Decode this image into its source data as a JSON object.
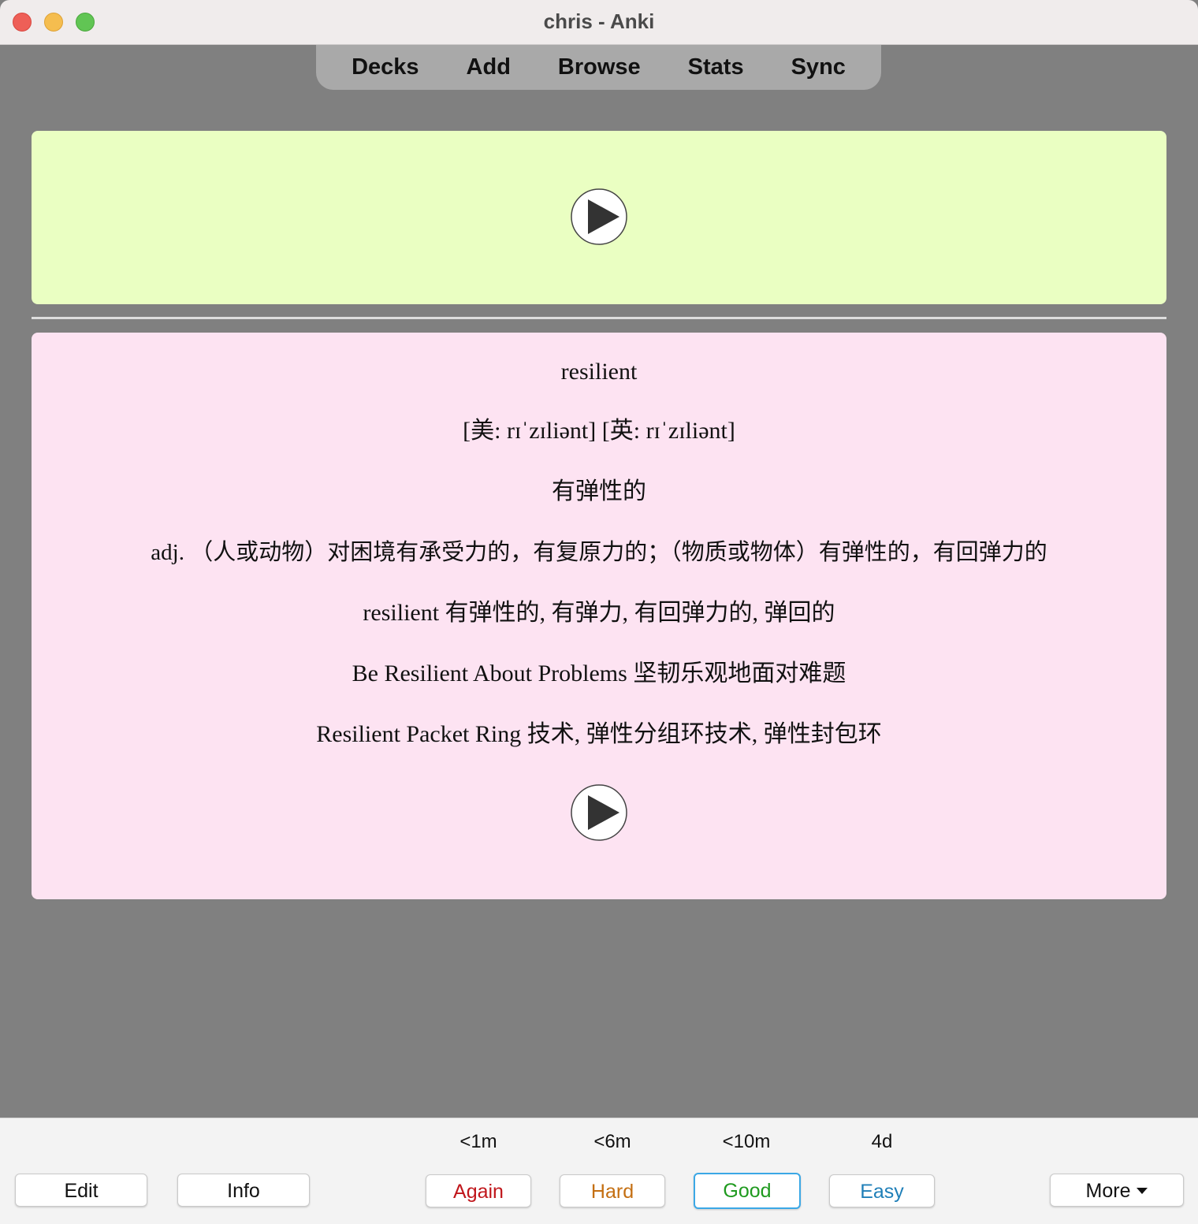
{
  "window": {
    "title": "chris - Anki"
  },
  "toolbar": {
    "items": [
      "Decks",
      "Add",
      "Browse",
      "Stats",
      "Sync"
    ]
  },
  "card": {
    "front": {
      "audio_icon": "play-icon"
    },
    "back": {
      "word": "resilient",
      "phonetic": "[美: rɪˈzɪliənt] [英: rɪˈzɪliənt]",
      "meaning_short": "有弹性的",
      "definition": "adj. （人或动物）对困境有承受力的，有复原力的；（物质或物体）有弹性的，有回弹力的",
      "phrase_1": "resilient 有弹性的, 有弹力, 有回弹力的, 弹回的",
      "phrase_2": "Be Resilient About Problems 坚韧乐观地面对难题",
      "phrase_3": "Resilient Packet Ring 技术, 弹性分组环技术, 弹性封包环",
      "audio_icon": "play-icon"
    }
  },
  "bottom": {
    "edit_label": "Edit",
    "info_label": "Info",
    "more_label": "More",
    "answers": [
      {
        "label": "Again",
        "interval": "<1m",
        "color": "#c0161b"
      },
      {
        "label": "Hard",
        "interval": "<6m",
        "color": "#c46f12"
      },
      {
        "label": "Good",
        "interval": "<10m",
        "color": "#1f9a1f"
      },
      {
        "label": "Easy",
        "interval": "4d",
        "color": "#1f7fb8"
      }
    ]
  },
  "colors": {
    "background": "#808080",
    "front_card": "#eaffc2",
    "back_card": "#fde3f2",
    "focus_ring": "#3ba8e6"
  }
}
